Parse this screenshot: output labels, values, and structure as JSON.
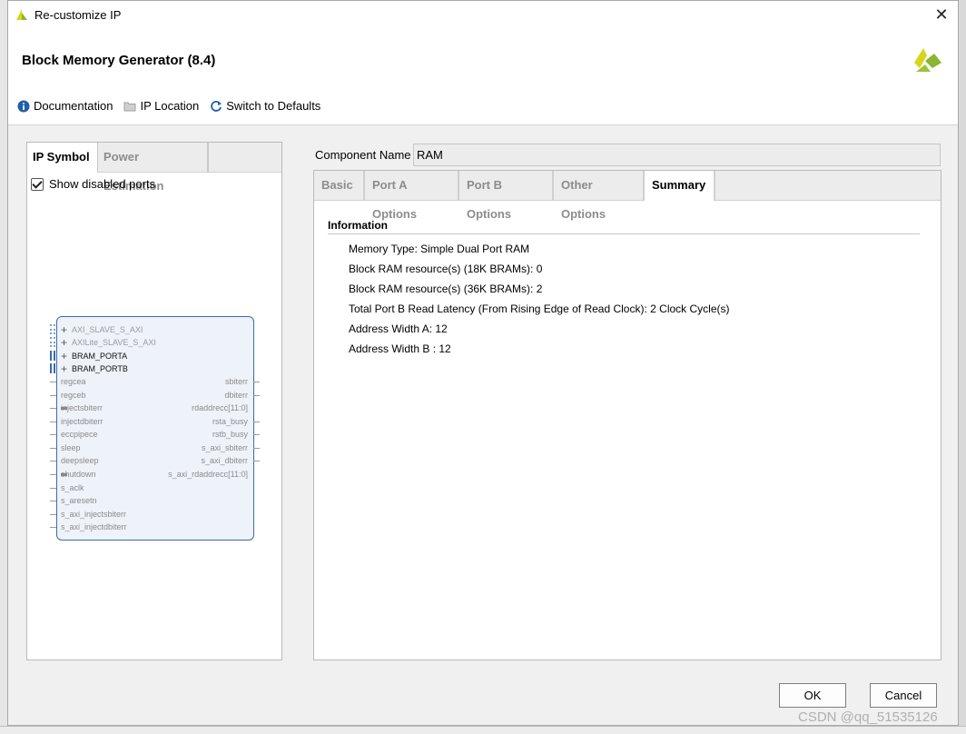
{
  "window": {
    "title": "Re-customize IP"
  },
  "header": {
    "ip_title": "Block Memory Generator (8.4)"
  },
  "toolbar": {
    "documentation": "Documentation",
    "ip_location": "IP Location",
    "switch_defaults": "Switch to Defaults"
  },
  "left_tabs": [
    "IP Symbol",
    "Power Estimation"
  ],
  "show_disabled": {
    "label": "Show disabled ports",
    "checked": true
  },
  "symbol": {
    "buses": [
      "AXI_SLAVE_S_AXI",
      "AXILite_SLAVE_S_AXI",
      "BRAM_PORTA",
      "BRAM_PORTB"
    ],
    "left_ports": [
      "regcea",
      "regceb",
      "injectsbiterr",
      "injectdbiterr",
      "eccpipece",
      "sleep",
      "deepsleep",
      "shutdown",
      "s_aclk",
      "s_aresetn",
      "s_axi_injectsbiterr",
      "s_axi_injectdbiterr"
    ],
    "right_ports": [
      "sbiterr",
      "dbiterr",
      "rdaddrecc[11:0]",
      "rsta_busy",
      "rstb_busy",
      "s_axi_sbiterr",
      "s_axi_dbiterr",
      "s_axi_rdaddrecc[11:0]"
    ]
  },
  "component": {
    "label": "Component Name",
    "value": "RAM"
  },
  "right_tabs": [
    "Basic",
    "Port A Options",
    "Port B Options",
    "Other Options",
    "Summary"
  ],
  "summary": {
    "heading": "Information",
    "items": [
      "Memory Type: Simple Dual Port RAM",
      "Block RAM resource(s) (18K BRAMs): 0",
      "Block RAM resource(s) (36K BRAMs): 2",
      "Total Port B Read Latency (From Rising Edge of Read Clock): 2 Clock Cycle(s)",
      "Address Width A: 12",
      "Address Width B : 12"
    ]
  },
  "buttons": {
    "ok": "OK",
    "cancel": "Cancel"
  },
  "watermark": "CSDN @qq_51535126",
  "colors": {
    "brand_green": "#8bb533",
    "brand_yellow": "#d7d61e",
    "symbol_border": "#3d6aa8",
    "info_icon": "#1f5fa6"
  }
}
